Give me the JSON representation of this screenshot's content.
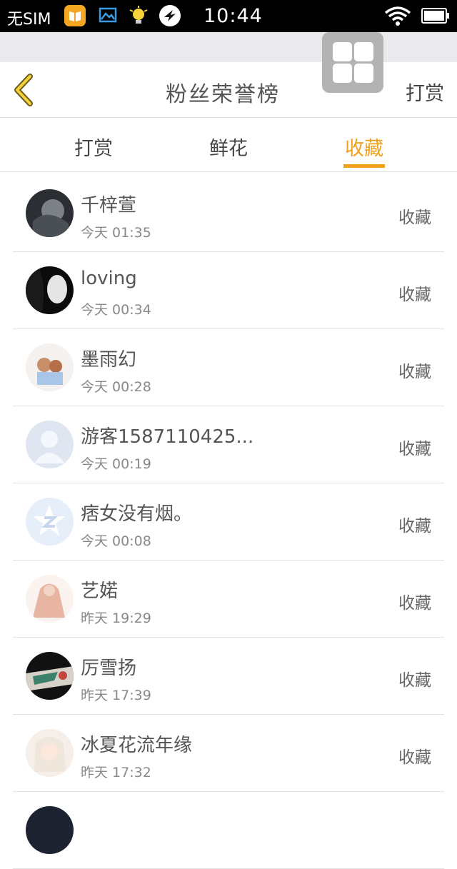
{
  "status_bar": {
    "carrier": "无SIM",
    "time": "10:44",
    "icons": [
      "reader-app-icon",
      "gallery-app-icon",
      "bulb-notification-icon",
      "bird-app-icon",
      "wifi-icon",
      "battery-icon"
    ]
  },
  "header": {
    "back_icon": "chevron-left-icon",
    "title": "粉丝荣誉榜",
    "action": "打赏"
  },
  "floating_button": {
    "icon": "grid-icon"
  },
  "tabs": [
    {
      "label": "打赏",
      "active": false
    },
    {
      "label": "鲜花",
      "active": false
    },
    {
      "label": "收藏",
      "active": true
    }
  ],
  "list": [
    {
      "name": "千梓萱",
      "time": "今天 01:35",
      "action": "收藏"
    },
    {
      "name": "loving",
      "time": "今天 00:34",
      "action": "收藏"
    },
    {
      "name": "墨雨幻",
      "time": "今天 00:28",
      "action": "收藏"
    },
    {
      "name": "游客1587110425...",
      "time": "今天 00:19",
      "action": "收藏"
    },
    {
      "name": "痞女没有烟。",
      "time": "今天 00:08",
      "action": "收藏"
    },
    {
      "name": "艺婼",
      "time": "昨天 19:29",
      "action": "收藏"
    },
    {
      "name": "厉雪扬",
      "time": "昨天 17:39",
      "action": "收藏"
    },
    {
      "name": "冰夏花流年缘",
      "time": "昨天 17:32",
      "action": "收藏"
    }
  ],
  "colors": {
    "accent": "#f2a21a",
    "status_bar_bg": "#000000",
    "divider": "#e3e3e3"
  }
}
